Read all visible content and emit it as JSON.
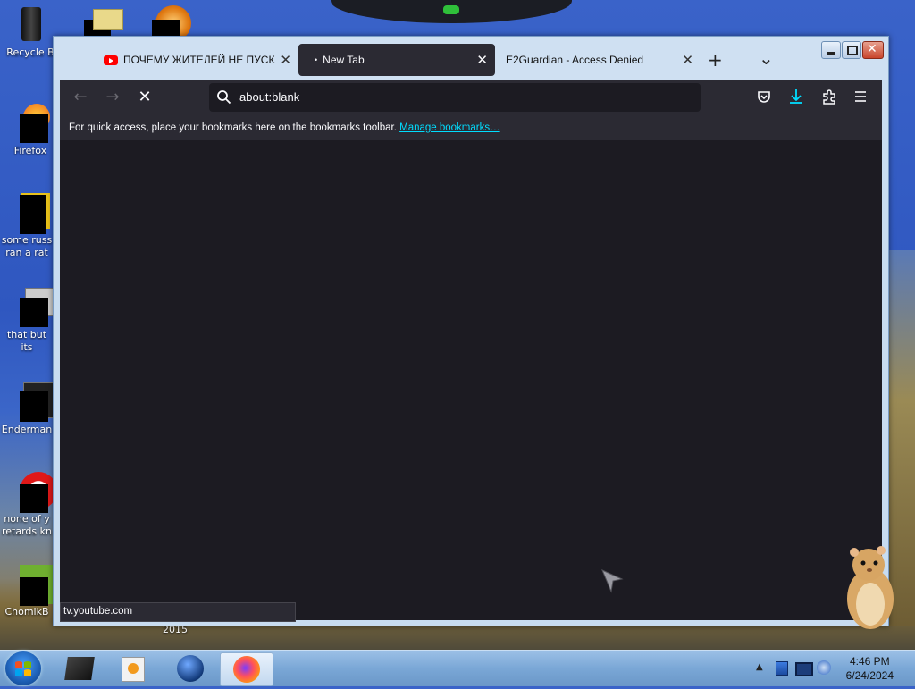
{
  "desktop": {
    "icons": [
      {
        "label": "Recycle B",
        "label2": ""
      },
      {
        "label": "Firefox",
        "label2": ""
      },
      {
        "label": "some russ",
        "label2": "ran a rat"
      },
      {
        "label": "that but its",
        "label2": ""
      },
      {
        "label": "Enderman",
        "label2": ""
      },
      {
        "label": "none of y",
        "label2": "retards kn"
      },
      {
        "label": "ChomikB",
        "label2": ""
      }
    ],
    "year_label": "2015"
  },
  "browser": {
    "tabs": [
      {
        "title": "ПОЧЕМУ ЖИТЕЛЕЙ НЕ ПУСКА",
        "icon": "youtube-icon",
        "active": false
      },
      {
        "title": "New Tab",
        "icon": "",
        "active": true
      },
      {
        "title": "E2Guardian - Access Denied",
        "icon": "",
        "active": false
      }
    ],
    "new_tab_symbol": "+",
    "list_all_tabs_symbol": "⌄",
    "url": "about:blank",
    "bookmarks_bar": {
      "hint": "For quick access, place your bookmarks here on the bookmarks toolbar.",
      "link": "Manage bookmarks…"
    },
    "status_url": "tv.youtube.com"
  },
  "taskbar": {
    "time": "4:46 PM",
    "date": "6/24/2024"
  },
  "colors": {
    "chrome": "#2b2a33",
    "content": "#1c1b22",
    "accent": "#00ddff"
  }
}
